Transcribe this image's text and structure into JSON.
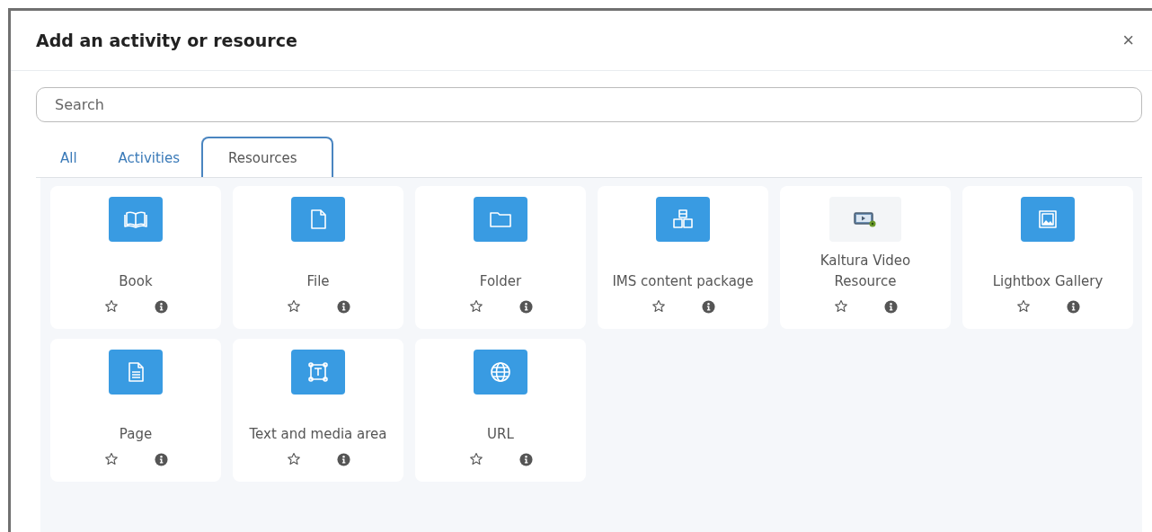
{
  "dialog": {
    "title": "Add an activity or resource",
    "close": "×"
  },
  "search": {
    "placeholder": "Search"
  },
  "tabs": [
    {
      "label": "All",
      "selected": false
    },
    {
      "label": "Activities",
      "selected": false
    },
    {
      "label": "Resources",
      "selected": true
    }
  ],
  "items": [
    {
      "name": "Book",
      "kind": "book",
      "starred": false
    },
    {
      "name": "File",
      "kind": "file",
      "starred": false
    },
    {
      "name": "Folder",
      "kind": "folder",
      "starred": false
    },
    {
      "name": "IMS content package",
      "kind": "package",
      "starred": false
    },
    {
      "name": "Kaltura Video Resource",
      "kind": "video",
      "starred": false
    },
    {
      "name": "Lightbox Gallery",
      "kind": "gallery",
      "starred": false
    },
    {
      "name": "Page",
      "kind": "page",
      "starred": false
    },
    {
      "name": "Text and media area",
      "kind": "textarea",
      "starred": false
    },
    {
      "name": "URL",
      "kind": "url",
      "starred": false
    }
  ]
}
